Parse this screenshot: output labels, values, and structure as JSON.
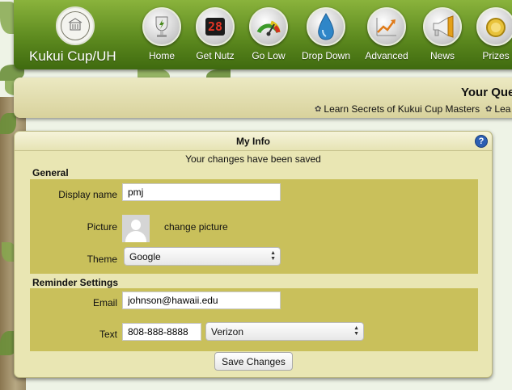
{
  "site": {
    "title": "Kukui Cup/UH"
  },
  "nav": [
    {
      "label": "Home",
      "icon": "trophy-icon"
    },
    {
      "label": "Get Nutz",
      "icon": "scoreboard-icon",
      "digits": "28"
    },
    {
      "label": "Go Low",
      "icon": "gauge-icon"
    },
    {
      "label": "Drop Down",
      "icon": "water-drop-icon"
    },
    {
      "label": "Advanced",
      "icon": "chart-arrow-icon"
    },
    {
      "label": "News",
      "icon": "megaphone-icon"
    },
    {
      "label": "Prizes",
      "icon": "medal-icon"
    }
  ],
  "quest": {
    "title": "Your Que",
    "links": [
      "Learn Secrets of Kukui Cup Masters",
      "Lea"
    ]
  },
  "panel": {
    "title": "My Info",
    "help": "?",
    "saved_message": "Your changes have been saved",
    "general": {
      "title": "General",
      "display_name_label": "Display name",
      "display_name_value": "pmj",
      "picture_label": "Picture",
      "change_picture": "change picture",
      "theme_label": "Theme",
      "theme_value": "Google"
    },
    "reminders": {
      "title": "Reminder Settings",
      "email_label": "Email",
      "email_value": "johnson@hawaii.edu",
      "text_label": "Text",
      "phone_value": "808-888-8888",
      "carrier_value": "Verizon"
    },
    "save_button": "Save Changes"
  },
  "colors": {
    "header_green": "#5d8a1f",
    "panel_bg": "#e9e6b3",
    "section_bg": "#c9c05b",
    "help_blue": "#2c5fb3"
  }
}
